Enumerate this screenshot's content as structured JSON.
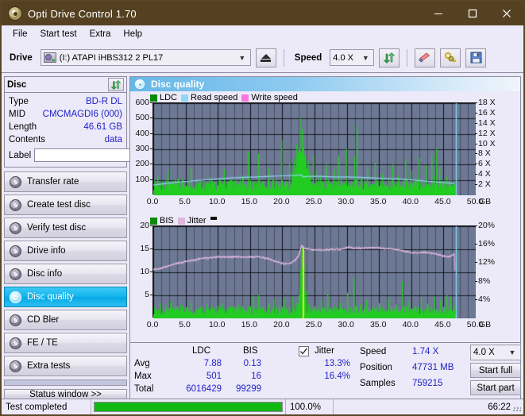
{
  "window": {
    "title": "Opti Drive Control 1.70",
    "icon": "disc-icon",
    "minimize": "–",
    "maximize": "□",
    "close": "✕"
  },
  "menu": {
    "items": [
      "File",
      "Start test",
      "Extra",
      "Help"
    ]
  },
  "toolbar": {
    "drive_label": "Drive",
    "drive_value": "(I:)  ATAPI iHBS312   2 PL17",
    "eject_icon": "eject-icon",
    "speed_label": "Speed",
    "speed_value": "4.0 X",
    "refresh_icon": "refresh-icon",
    "eraser_icon": "eraser-icon",
    "keys_icon": "keys-icon",
    "save_icon": "save-icon"
  },
  "disc_panel": {
    "title": "Disc",
    "refresh_icon": "refresh-icon",
    "rows": [
      {
        "label": "Type",
        "value": "BD-R DL"
      },
      {
        "label": "MID",
        "value": "CMCMAGDI6 (000)"
      },
      {
        "label": "Length",
        "value": "46.61 GB"
      },
      {
        "label": "Contents",
        "value": "data"
      }
    ],
    "label_label": "Label",
    "label_value": "",
    "label_placeholder": "",
    "disc_icon": "cd-icon"
  },
  "nav": {
    "items": [
      {
        "label": "Transfer rate",
        "active": false
      },
      {
        "label": "Create test disc",
        "active": false
      },
      {
        "label": "Verify test disc",
        "active": false
      },
      {
        "label": "Drive info",
        "active": false
      },
      {
        "label": "Disc info",
        "active": false
      },
      {
        "label": "Disc quality",
        "active": true
      },
      {
        "label": "CD Bler",
        "active": false
      },
      {
        "label": "FE / TE",
        "active": false
      },
      {
        "label": "Extra tests",
        "active": false
      }
    ],
    "status_window": "Status window >>"
  },
  "content": {
    "header": "Disc quality",
    "header_icon": "disc-quality-icon"
  },
  "chart_data": [
    {
      "type": "line",
      "name": "top-chart",
      "title": "",
      "legend": [
        {
          "label": "LDC",
          "color": "#0a8a0a"
        },
        {
          "label": "Read speed",
          "color": "#8ed8f8"
        },
        {
          "label": "Write speed",
          "color": "#f878e0"
        }
      ],
      "xlabel": "GB",
      "x_ticks": [
        "0.0",
        "5.0",
        "10.0",
        "15.0",
        "20.0",
        "25.0",
        "30.0",
        "35.0",
        "40.0",
        "45.0",
        "50.0"
      ],
      "xlim": [
        0,
        50
      ],
      "ylabel_left": "",
      "y_ticks_left": [
        "100",
        "200",
        "300",
        "400",
        "500",
        "600"
      ],
      "ylim_left": [
        0,
        600
      ],
      "ylabel_right": "",
      "y_ticks_right": [
        "2 X",
        "4 X",
        "6 X",
        "8 X",
        "10 X",
        "12 X",
        "14 X",
        "16 X",
        "18 X"
      ],
      "ylim_right": [
        0,
        18
      ],
      "grid": true,
      "series": [
        {
          "name": "LDC",
          "color": "#22cc22",
          "style": "bars",
          "x": [
            0.2,
            0.6,
            1.0,
            1.4,
            1.8,
            2.2,
            2.6,
            3.0,
            3.4,
            3.8,
            4.2,
            4.6,
            5.0,
            5.4,
            5.8,
            6.2,
            6.6,
            7.0,
            7.4,
            7.8,
            8.2,
            8.6,
            9.0,
            9.4,
            9.8,
            10.2,
            10.6,
            11.0,
            11.4,
            11.8,
            12.2,
            12.6,
            13.0,
            13.4,
            13.8,
            14.2,
            14.6,
            15.0,
            15.4,
            15.8,
            16.2,
            16.6,
            17.0,
            17.4,
            17.8,
            18.2,
            18.6,
            19.0,
            19.4,
            19.8,
            20.2,
            20.6,
            21.0,
            21.4,
            21.8,
            22.2,
            22.6,
            23.0,
            23.2,
            23.5,
            23.9,
            24.3,
            24.7,
            25.1,
            25.5,
            25.9,
            26.3,
            26.7,
            27.1,
            27.5,
            27.9,
            28.3,
            28.7,
            29.1,
            29.5,
            29.9,
            30.3,
            30.7,
            31.1,
            31.5,
            31.9,
            32.3,
            32.7,
            33.1,
            33.5,
            33.9,
            34.3,
            34.7,
            35.1,
            35.5,
            35.9,
            36.3,
            36.7,
            37.1,
            37.5,
            37.9,
            38.3,
            38.7,
            39.1,
            39.5,
            39.9,
            40.3,
            40.7,
            41.1,
            41.5,
            41.9,
            42.3,
            42.7,
            43.1,
            43.5,
            43.9,
            44.3,
            44.7,
            45.1,
            45.5,
            45.9,
            46.3,
            46.7
          ],
          "values": [
            60,
            130,
            45,
            90,
            55,
            160,
            40,
            70,
            50,
            110,
            35,
            95,
            60,
            45,
            180,
            65,
            40,
            90,
            55,
            70,
            45,
            120,
            60,
            85,
            40,
            95,
            55,
            170,
            45,
            60,
            95,
            40,
            75,
            55,
            130,
            45,
            280,
            60,
            85,
            40,
            270,
            55,
            70,
            45,
            180,
            60,
            110,
            40,
            75,
            360,
            55,
            90,
            210,
            150,
            240,
            330,
            500,
            430,
            290,
            180,
            230,
            120,
            265,
            160,
            90,
            130,
            60,
            200,
            100,
            55,
            170,
            75,
            260,
            110,
            45,
            300,
            65,
            90,
            250,
            455,
            70,
            120,
            50,
            190,
            80,
            60,
            210,
            95,
            55,
            140,
            70,
            105,
            45,
            200,
            60,
            130,
            55,
            90,
            240,
            70,
            160,
            50,
            110,
            245,
            60,
            95,
            195,
            70,
            265,
            130,
            305,
            180,
            90,
            55,
            120,
            80,
            45,
            60
          ]
        },
        {
          "name": "Read speed",
          "color": "#8ed8f8",
          "style": "line",
          "x": [
            0,
            2,
            4,
            6,
            8,
            10,
            12,
            14,
            16,
            18,
            20,
            22,
            23,
            23.2,
            24,
            26,
            28,
            30,
            32,
            34,
            36,
            38,
            40,
            42,
            44,
            46,
            46.7
          ],
          "values": [
            2.0,
            2.3,
            2.6,
            2.8,
            3.0,
            3.2,
            3.4,
            3.5,
            3.6,
            3.7,
            3.8,
            3.9,
            4.0,
            3.6,
            3.7,
            3.7,
            3.6,
            3.6,
            3.5,
            3.4,
            3.3,
            3.2,
            3.0,
            2.8,
            2.6,
            2.4,
            2.3
          ]
        }
      ],
      "marker_x": 46.9,
      "marker_color": "#7fd4f5"
    },
    {
      "type": "line",
      "name": "bottom-chart",
      "title": "",
      "legend": [
        {
          "label": "BIS",
          "color": "#0a8a0a"
        },
        {
          "label": "Jitter",
          "color": "#dfb6dd"
        }
      ],
      "xlabel": "GB",
      "x_ticks": [
        "0.0",
        "5.0",
        "10.0",
        "15.0",
        "20.0",
        "25.0",
        "30.0",
        "35.0",
        "40.0",
        "45.0",
        "50.0"
      ],
      "xlim": [
        0,
        50
      ],
      "y_ticks_left": [
        "5",
        "10",
        "15",
        "20"
      ],
      "ylim_left": [
        0,
        20
      ],
      "y_ticks_right": [
        "4%",
        "8%",
        "12%",
        "16%",
        "20%"
      ],
      "ylim_right": [
        0,
        20
      ],
      "grid": true,
      "series": [
        {
          "name": "BIS",
          "color": "#22cc22",
          "style": "bars",
          "x": [
            0.2,
            0.6,
            1.0,
            1.4,
            1.8,
            2.2,
            2.6,
            3.0,
            3.4,
            3.8,
            4.2,
            4.6,
            5.0,
            5.4,
            5.8,
            6.2,
            6.6,
            7.0,
            7.4,
            7.8,
            8.2,
            8.6,
            9.0,
            9.4,
            9.8,
            10.2,
            10.6,
            11.0,
            11.4,
            11.8,
            12.2,
            12.6,
            13.0,
            13.4,
            13.8,
            14.2,
            14.6,
            15.0,
            15.4,
            15.8,
            16.2,
            16.6,
            17.0,
            17.4,
            17.8,
            18.2,
            18.6,
            19.0,
            19.4,
            19.8,
            20.2,
            20.6,
            21.0,
            21.4,
            21.8,
            22.2,
            22.6,
            22.9,
            23.1,
            23.3,
            23.6,
            24.0,
            24.5,
            25.0,
            25.5,
            26.0,
            26.5,
            27.0,
            27.5,
            28.0,
            28.5,
            29.0,
            29.5,
            30.0,
            30.5,
            31.0,
            31.5,
            32.0,
            32.5,
            33.0,
            33.5,
            34.0,
            34.5,
            35.0,
            35.5,
            36.0,
            36.5,
            37.0,
            37.5,
            38.0,
            38.5,
            39.0,
            39.5,
            40.0,
            40.5,
            41.0,
            41.5,
            42.0,
            42.5,
            43.0,
            43.5,
            44.0,
            44.5,
            45.0,
            45.5,
            46.0,
            46.5
          ],
          "values": [
            2.0,
            1.6,
            3.2,
            1.4,
            2.6,
            1.8,
            3.6,
            1.5,
            2.2,
            1.7,
            2.9,
            1.4,
            2.4,
            1.6,
            3.5,
            1.5,
            2.0,
            1.8,
            2.7,
            1.4,
            3.1,
            1.6,
            2.3,
            1.9,
            2.8,
            1.5,
            3.3,
            1.7,
            2.1,
            1.6,
            2.5,
            1.8,
            3.0,
            1.4,
            2.2,
            1.9,
            2.6,
            1.5,
            4.9,
            1.7,
            5.1,
            1.6,
            2.4,
            1.8,
            3.2,
            1.5,
            4.2,
            1.7,
            2.9,
            1.6,
            4.4,
            1.9,
            2.6,
            4.8,
            2.1,
            3.4,
            4.2,
            8.5,
            15.6,
            12.0,
            6.0,
            3.2,
            2.0,
            2.6,
            1.8,
            4.1,
            2.3,
            5.3,
            1.9,
            2.8,
            2.1,
            3.5,
            1.7,
            5.6,
            2.4,
            8.9,
            2.0,
            3.1,
            1.8,
            4.0,
            2.2,
            2.7,
            1.9,
            3.3,
            2.5,
            1.8,
            4.3,
            2.1,
            3.0,
            1.7,
            8.0,
            2.4,
            3.6,
            1.9,
            2.8,
            2.2,
            4.5,
            1.8,
            3.2,
            2.6,
            4.7,
            2.0,
            3.9,
            2.3,
            5.0,
            4.6,
            2.8
          ]
        },
        {
          "name": "Jitter",
          "color": "#dfb6dd",
          "style": "line",
          "x": [
            0,
            0.5,
            1,
            1.5,
            2,
            3,
            4,
            5,
            6,
            7,
            8,
            9,
            10,
            11,
            12,
            13,
            14,
            15,
            16,
            17,
            18,
            19,
            20,
            20.5,
            21,
            21.5,
            22,
            22.5,
            23,
            23.1,
            23.5,
            24,
            25,
            26,
            27,
            28,
            29,
            30,
            30.5,
            31,
            32,
            33,
            34,
            35,
            36,
            37,
            38,
            39,
            40,
            41,
            42,
            43,
            44,
            45,
            46,
            46.7
          ],
          "values": [
            10.7,
            10.6,
            10.8,
            11.0,
            11.3,
            11.7,
            12.0,
            12.3,
            12.6,
            12.9,
            13.1,
            13.2,
            13.3,
            13.4,
            13.4,
            13.4,
            13.3,
            13.3,
            13.4,
            13.2,
            12.9,
            12.4,
            11.9,
            11.8,
            11.9,
            12.2,
            12.7,
            13.5,
            15.8,
            15.6,
            15.2,
            15.0,
            14.9,
            14.8,
            14.9,
            15.0,
            15.0,
            15.4,
            15.5,
            15.3,
            15.2,
            15.3,
            15.4,
            15.3,
            15.1,
            15.0,
            14.9,
            14.6,
            14.3,
            14.2,
            14.3,
            14.2,
            13.9,
            13.5,
            13.4,
            14.0
          ]
        }
      ],
      "marker_x": 46.9,
      "marker_color": "#7fd4f5"
    }
  ],
  "stats": {
    "col_headers": [
      "LDC",
      "BIS"
    ],
    "rows": [
      {
        "label": "Avg",
        "ldc": "7.88",
        "bis": "0.13",
        "jitter": "13.3%"
      },
      {
        "label": "Max",
        "ldc": "501",
        "bis": "16",
        "jitter": "16.4%"
      },
      {
        "label": "Total",
        "ldc": "6016429",
        "bis": "99299",
        "jitter": ""
      }
    ],
    "jitter_label": "Jitter",
    "jitter_checked": true,
    "speed_label": "Speed",
    "speed_value": "1.74 X",
    "position_label": "Position",
    "position_value": "47731 MB",
    "samples_label": "Samples",
    "samples_value": "759215",
    "speed_select": "4.0 X",
    "start_full": "Start full",
    "start_part": "Start part"
  },
  "statusbar": {
    "message": "Test completed",
    "progress_percent": 100,
    "progress_text": "100.0%",
    "elapsed": "66:22"
  },
  "colors": {
    "titlebar": "#554122",
    "accent": "#2222c8",
    "plot_bg": "#6d7994",
    "green": "#22cc22",
    "progress": "#13b913"
  }
}
